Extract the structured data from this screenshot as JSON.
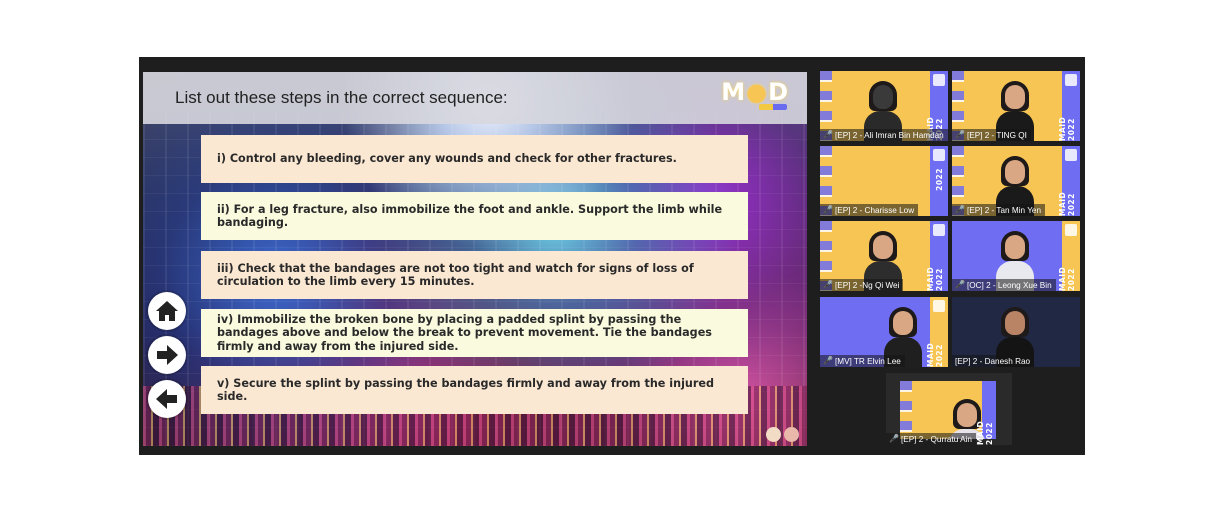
{
  "slide": {
    "question": "List out these steps in the correct sequence:",
    "logo_text": "M🌕D",
    "steps": [
      "i) Control any bleeding, cover any wounds and check for other fractures.",
      "ii) For a leg fracture, also immobilize the foot and ankle. Support the limb while bandaging.",
      "iii) Check that the bandages are not too tight and watch for signs of loss of circulation to the limb every 15 minutes.",
      "iv) Immobilize the broken bone by placing a padded splint by passing the bandages above and below the break to prevent movement. Tie the bandages firmly and away from the injured side.",
      "v) Secure the splint by passing the bandages firmly and away from the injured side."
    ],
    "nav": {
      "home": "home",
      "next": "next",
      "back": "back"
    }
  },
  "participants": [
    {
      "name": "[EP] 2 - Ali Imran Bin Hamdan",
      "banner": "MAID 2022"
    },
    {
      "name": "[EP] 2 - TING QI",
      "banner": "MAID 2022"
    },
    {
      "name": "[EP] 2 - Charisse Low",
      "banner": "2022"
    },
    {
      "name": "[EP] 2 - Tan Min Yen",
      "banner": "MAID 2022"
    },
    {
      "name": "[EP] 2 -Ng Qi Wei",
      "banner": "MAID 2022"
    },
    {
      "name": "[OC] 2 - Leong Xue Bin",
      "banner": "MAID 2022"
    },
    {
      "name": "[MV] TR Elvin Lee",
      "banner": "MAID 2022"
    },
    {
      "name": "[EP] 2 - Danesh Rao",
      "banner": ""
    },
    {
      "name": "[EP] 2 - Qurratu Ain",
      "banner": "MAID 2022"
    }
  ],
  "icons": {
    "home": "home-icon",
    "next": "arrow-right-icon",
    "back": "arrow-left-icon",
    "mic": "mic-muted-icon"
  },
  "colors": {
    "accent_yellow": "#f6c553",
    "accent_purple": "#6f6ef2",
    "step_peach": "#fbe8d3",
    "step_cream": "#fafadf"
  }
}
